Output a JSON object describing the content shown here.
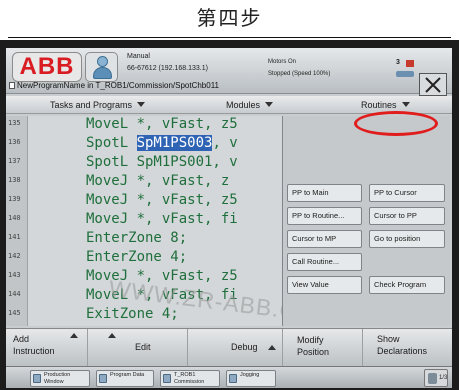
{
  "caption": "第四步",
  "watermark": "WWW.ZR-ABB.COM",
  "header": {
    "logo": "ABB",
    "mode": "Manual",
    "host": "66-67612 (192.168.133.1)",
    "motors": "Motors On",
    "state": "Stopped (Speed 100%)",
    "quickset_value": "3",
    "path": "NewProgramName in T_ROB1/Commission/SpotChb011",
    "icons": {
      "user": "user-icon",
      "close": "close-icon"
    }
  },
  "menubar": {
    "tasks": "Tasks and Programs",
    "modules": "Modules",
    "routines": "Routines"
  },
  "code": {
    "lines": [
      {
        "num": "135",
        "pre": "MoveL *, vFast, z5",
        "hl": "",
        "post": ""
      },
      {
        "num": "136",
        "pre": "SpotL ",
        "hl": "SpM1PS003",
        "post": ", v"
      },
      {
        "num": "137",
        "pre": "SpotL SpM1PS001, v",
        "hl": "",
        "post": ""
      },
      {
        "num": "138",
        "pre": "MoveJ *, vFast, z",
        "hl": "",
        "post": ""
      },
      {
        "num": "139",
        "pre": "MoveJ *, vFast, z5",
        "hl": "",
        "post": ""
      },
      {
        "num": "140",
        "pre": "MoveJ *, vFast, fi",
        "hl": "",
        "post": ""
      },
      {
        "num": "141",
        "pre": "EnterZone 8;",
        "hl": "",
        "post": ""
      },
      {
        "num": "142",
        "pre": "EnterZone 4;",
        "hl": "",
        "post": ""
      },
      {
        "num": "143",
        "pre": "MoveJ *, vFast, z5",
        "hl": "",
        "post": ""
      },
      {
        "num": "144",
        "pre": "MoveL *, vFast, fi",
        "hl": "",
        "post": ""
      },
      {
        "num": "145",
        "pre": "ExitZone 4;",
        "hl": "",
        "post": ""
      }
    ]
  },
  "popup": {
    "pp_to_main": "PP to Main",
    "pp_to_cursor": "PP to Cursor",
    "pp_to_routine": "PP to Routine...",
    "cursor_to_pp": "Cursor to PP",
    "cursor_to_mp": "Cursor to MP",
    "go_to_position": "Go to position",
    "call_routine": "Call Routine...",
    "view_value": "View Value",
    "check_program": "Check Program"
  },
  "function_bar": {
    "add_instruction_1": "Add",
    "add_instruction_2": "Instruction",
    "edit": "Edit",
    "debug": "Debug",
    "modify_position_1": "Modify",
    "modify_position_2": "Position",
    "show_declarations_1": "Show",
    "show_declarations_2": "Declarations"
  },
  "taskbar": {
    "production": "Production Window",
    "program_data": "Program Data",
    "t_rob1": "T_ROB1 Commission",
    "jogging": "Jogging",
    "unit": "1/3"
  }
}
